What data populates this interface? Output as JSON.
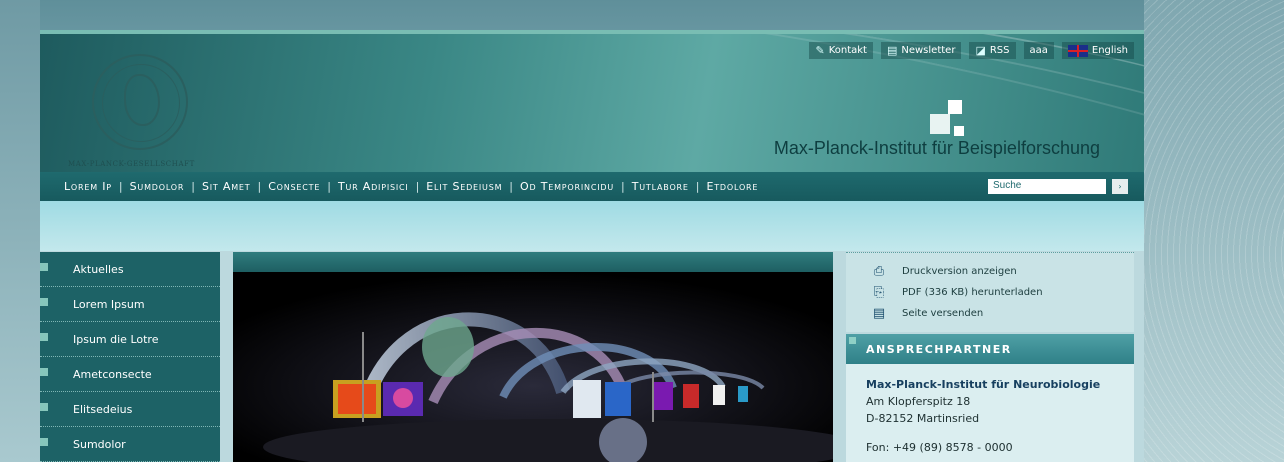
{
  "top_links": [
    {
      "label": "Kontakt",
      "icon": "edit-icon"
    },
    {
      "label": "Newsletter",
      "icon": "newsletter-icon"
    },
    {
      "label": "RSS",
      "icon": "rss-icon"
    },
    {
      "label": "aaa",
      "icon": "font-size-icon"
    },
    {
      "label": "English",
      "icon": "uk-flag-icon"
    }
  ],
  "logo": {
    "text": "MAX-PLANCK-GESELLSCHAFT"
  },
  "institute": {
    "name": "Max-Planck-Institut für Beispielforschung"
  },
  "nav": {
    "items": [
      "Lorem Ip",
      "Sumdolor",
      "Sit Amet",
      "Consecte",
      "Tur Adipisici",
      "Elit Sedeiusm",
      "Od Temporincidu",
      "Tutlabore",
      "Etdolore"
    ],
    "search_placeholder": "Suche",
    "search_button": "›"
  },
  "sidebar": {
    "items": [
      "Aktuelles",
      "Lorem Ipsum",
      "Ipsum die Lotre",
      "Ametconsecte",
      "Elitsedeius",
      "Sumdolor"
    ]
  },
  "tools": [
    {
      "label": "Druckversion anzeigen",
      "icon": "print-icon"
    },
    {
      "label": "PDF (336 KB) herunterladen",
      "icon": "pdf-download-icon"
    },
    {
      "label": "Seite versenden",
      "icon": "send-page-icon"
    }
  ],
  "contact": {
    "heading": "ANSPRECHPARTNER",
    "org": "Max-Planck-Institut für Neurobiologie",
    "street": "Am Klopferspitz 18",
    "city": "D-82152 Martinsried",
    "partial": "Fon: +49 (89) 8578 - 0000"
  },
  "colors": {
    "header_teal": "#3a8785",
    "nav_bg": "#1f6a6e",
    "sidebar_bg": "#1d6266",
    "accent_green": "#86c6bb"
  }
}
